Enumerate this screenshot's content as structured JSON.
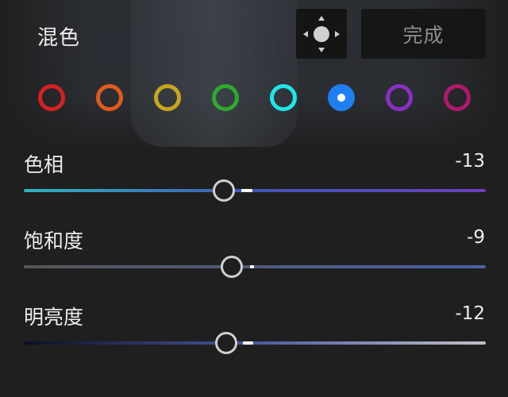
{
  "header": {
    "title": "混色",
    "target_tool_icon": "move-target-icon",
    "done_label": "完成"
  },
  "swatches": [
    {
      "name": "red",
      "color": "#d42121",
      "selected": false
    },
    {
      "name": "orange",
      "color": "#e05a1b",
      "selected": false
    },
    {
      "name": "yellow",
      "color": "#c8a51a",
      "selected": false
    },
    {
      "name": "green",
      "color": "#2ea82e",
      "selected": false
    },
    {
      "name": "aqua",
      "color": "#1fe6e6",
      "selected": false
    },
    {
      "name": "blue",
      "color": "#1f7ff0",
      "selected": true
    },
    {
      "name": "purple",
      "color": "#8a2fc4",
      "selected": false
    },
    {
      "name": "magenta",
      "color": "#b0176f",
      "selected": false
    }
  ],
  "controls": {
    "hue": {
      "label": "色相",
      "value": "-13",
      "colors": [
        "#2fb3bd",
        "#3f55b5",
        "#6a3fc0"
      ]
    },
    "saturation": {
      "label": "饱和度",
      "value": "-9",
      "colors": [
        "#555555",
        "#4a5fa8"
      ]
    },
    "luminance": {
      "label": "明亮度",
      "value": "-12",
      "colors": [
        "#0b0f22",
        "#4a5aa0",
        "#c0c0c8"
      ]
    }
  }
}
